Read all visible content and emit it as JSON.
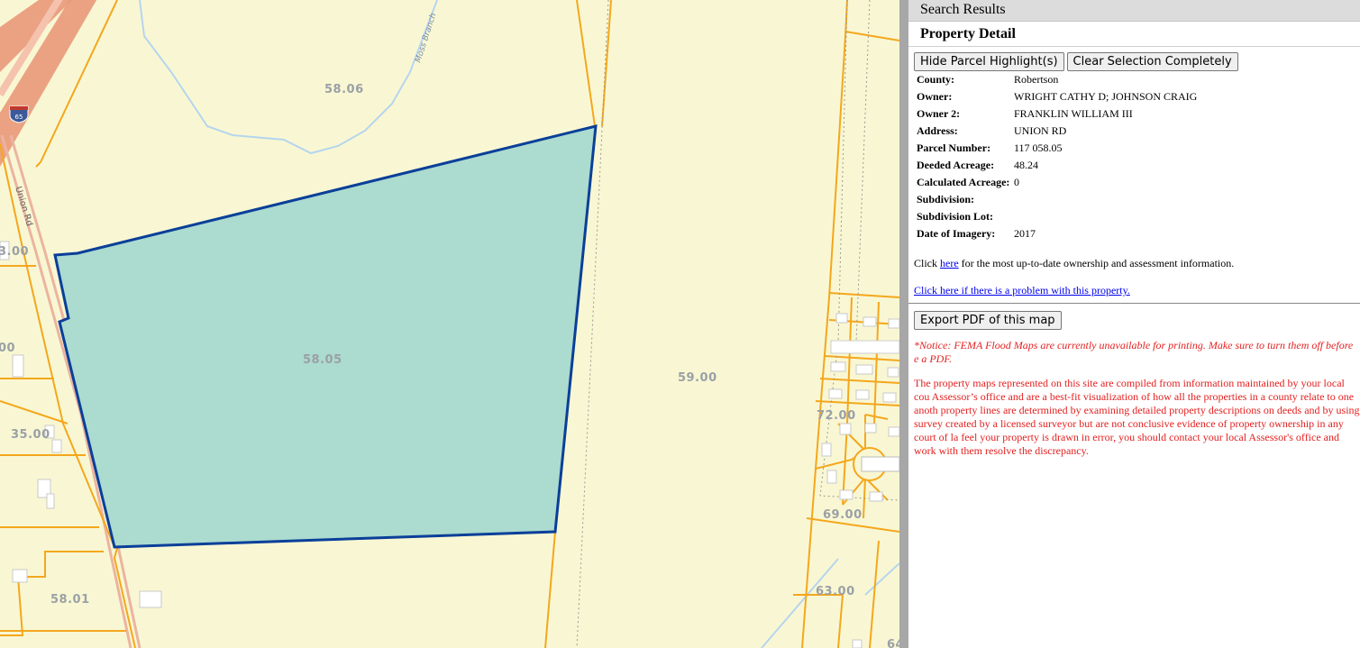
{
  "map": {
    "parcel_labels": [
      "58.06",
      "58.05",
      "59.00",
      "3.00",
      "00",
      "35.00",
      "58.01",
      "72.00",
      "69.00",
      "63.00",
      "64"
    ],
    "road_label": "Union Rd",
    "stream_label": "Moss Branch",
    "shield_label": "65",
    "colors": {
      "background": "#f9f7d3",
      "parcel_line": "#f4a71d",
      "highlight_fill": "#acdbcf",
      "highlight_stroke": "#0a3f99",
      "highway": "#e9987a",
      "stream": "#b5d5ee"
    }
  },
  "panel": {
    "search_results_label": "Search Results",
    "property_detail_label": "Property Detail",
    "buttons": {
      "hide_highlight": "Hide Parcel Highlight(s)",
      "clear_selection": "Clear Selection Completely",
      "export_pdf": "Export PDF of this map"
    },
    "fields": [
      {
        "label": "County:",
        "value": "Robertson"
      },
      {
        "label": "Owner:",
        "value": "WRIGHT CATHY D; JOHNSON CRAIG"
      },
      {
        "label": "Owner 2:",
        "value": "FRANKLIN WILLIAM III"
      },
      {
        "label": "Address:",
        "value": "UNION RD"
      },
      {
        "label": "Parcel Number:",
        "value": "117 058.05"
      },
      {
        "label": "Deeded Acreage:",
        "value": "48.24"
      },
      {
        "label": "Calculated Acreage:",
        "value": "0"
      },
      {
        "label": "Subdivision:",
        "value": ""
      },
      {
        "label": "Subdivision Lot:",
        "value": ""
      },
      {
        "label": "Date of Imagery:",
        "value": "2017"
      }
    ],
    "click_prefix": "Click ",
    "click_link": "here",
    "click_suffix": " for the most up-to-date ownership and assessment information.",
    "problem_link": "Click here if there is a problem with this property.",
    "notice_text": "*Notice: FEMA Flood Maps are currently unavailable for printing. Make sure to turn them off before e a PDF.",
    "disclaimer_text": "The property maps represented on this site are compiled from information maintained by your local cou Assessor’s office and are a best-fit visualization of how all the properties in a county relate to one anoth property lines are determined by examining detailed property descriptions on deeds and by using survey created by a licensed surveyor but are not conclusive evidence of property ownership in any court of la feel your property is drawn in error, you should contact your local Assessor's office and work with them resolve the discrepancy."
  }
}
